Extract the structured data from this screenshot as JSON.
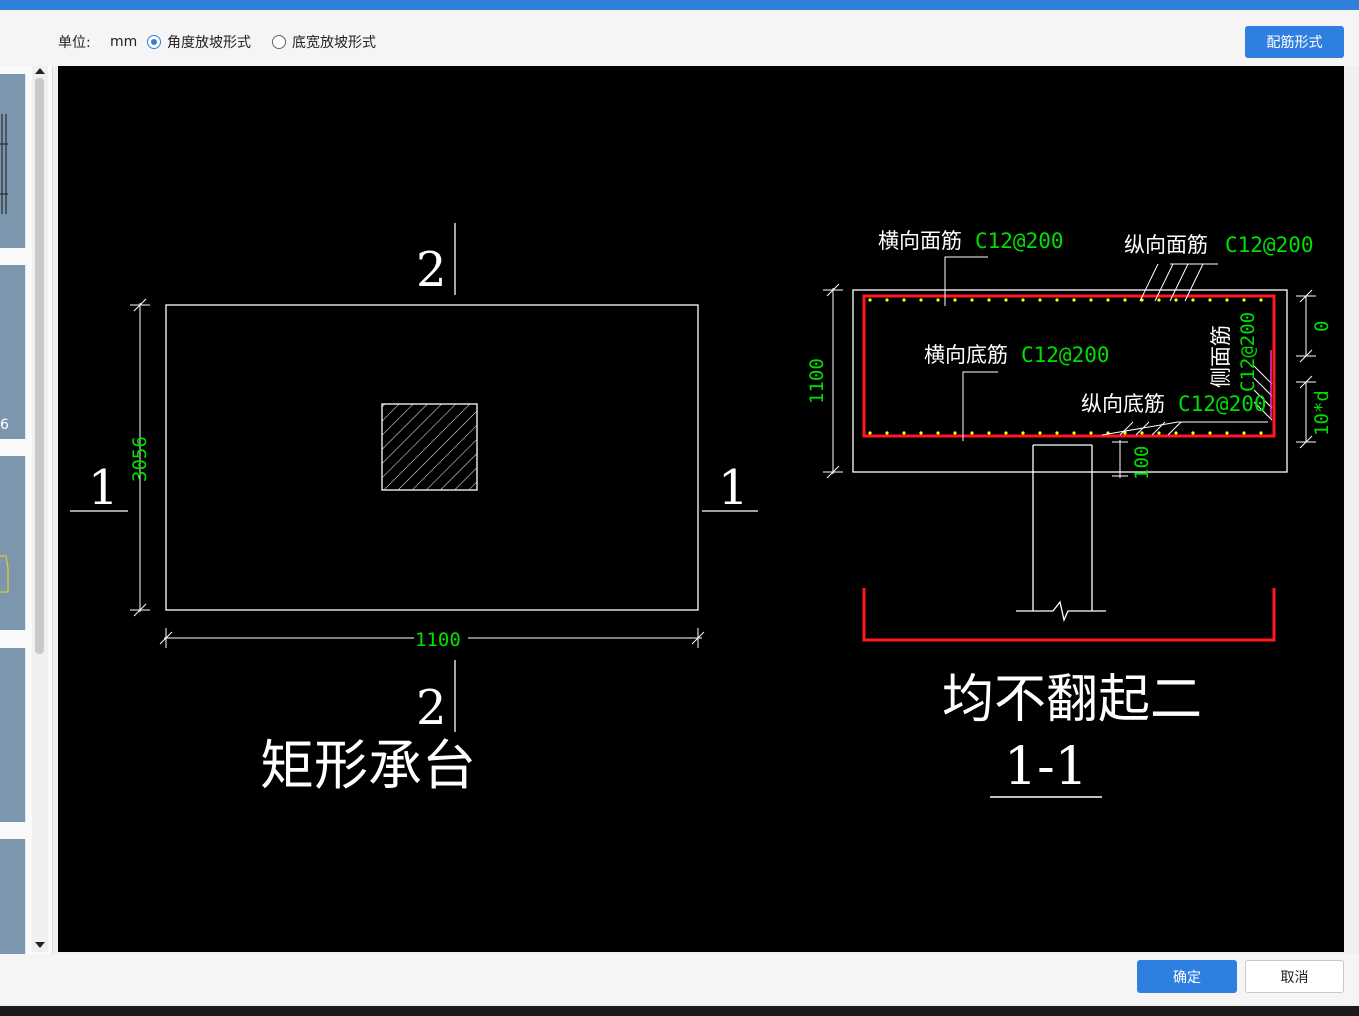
{
  "toolbar": {
    "unit_label": "单位:",
    "unit_value": "mm",
    "radio_angle": "角度放坡形式",
    "radio_width": "底宽放坡形式",
    "selected": "角度放坡形式",
    "rebar_button": "配筋形式"
  },
  "sidebar": {
    "visible_number": "6"
  },
  "drawing": {
    "plan": {
      "title": "矩形承台",
      "section_mark_2_top": "2",
      "section_mark_2_bottom": "2",
      "section_mark_1_left": "1",
      "section_mark_1_right": "1",
      "dim_height": "3056",
      "dim_width": "1100"
    },
    "section": {
      "label_trans_top_name": "横向面筋",
      "label_trans_top_value": "C12@200",
      "label_long_top_name": "纵向面筋",
      "label_long_top_value": "C12@200",
      "label_trans_bottom_name": "横向底筋",
      "label_trans_bottom_value": "C12@200",
      "label_long_bottom_name": "纵向底筋",
      "label_long_bottom_value": "C12@200",
      "label_side_name": "侧面筋",
      "label_side_value": "C12@200",
      "dim_height": "1100",
      "dim_right_top": "0",
      "dim_right_bottom": "10*d",
      "dim_col": "100",
      "caption": "均不翻起二",
      "section_name": "1-1"
    },
    "colors": {
      "line": "#ffffff",
      "dimension": "#00e000",
      "rebar": "#ff1a1a",
      "rebar_dot": "#ffff00"
    }
  },
  "footer": {
    "ok": "确定",
    "cancel": "取消"
  }
}
